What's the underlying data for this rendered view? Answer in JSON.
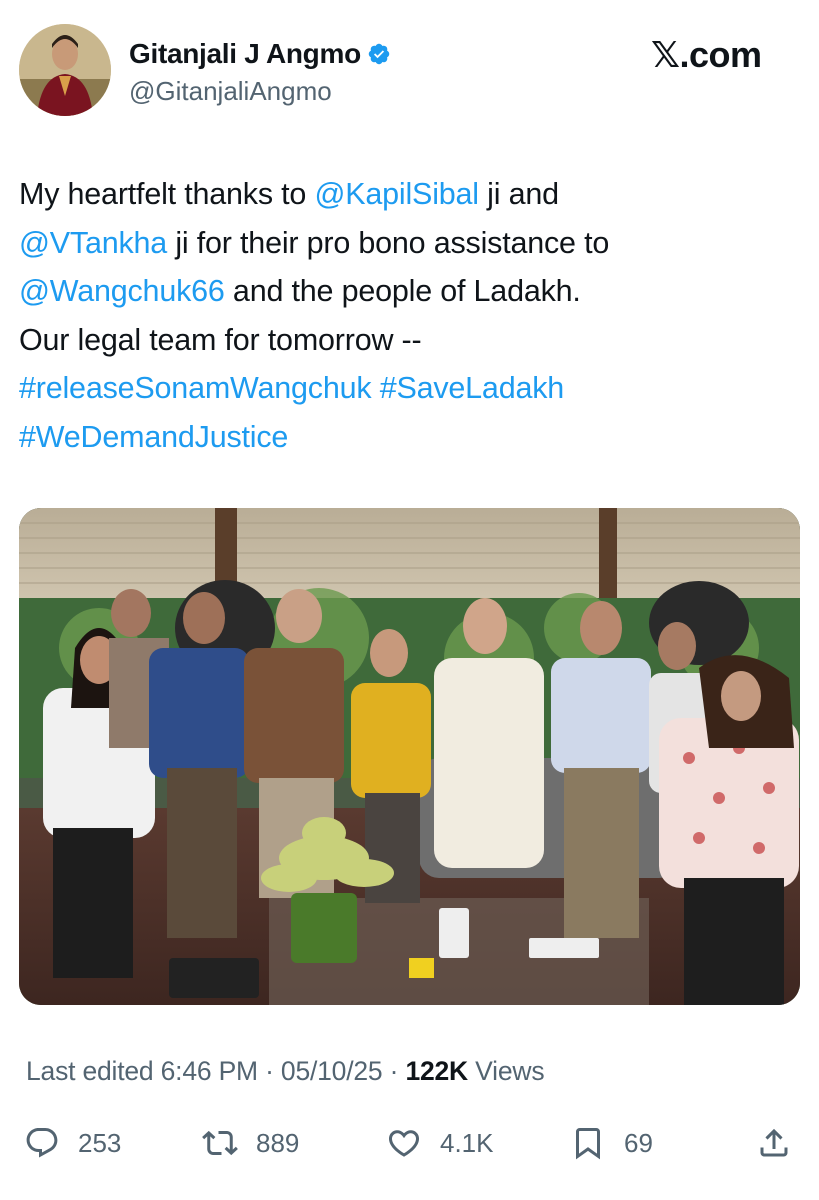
{
  "author": {
    "display_name": "Gitanjali J Angmo",
    "handle": "@GitanjaliAngmo",
    "verified": true,
    "verified_color": "#1d9bf0"
  },
  "brand": {
    "logo_text": "𝕏.com"
  },
  "tweet": {
    "lines": [
      [
        {
          "text": "My heartfelt thanks to ",
          "link": false
        },
        {
          "text": "@KapilSibal",
          "link": true
        },
        {
          "text": " ji and",
          "link": false
        }
      ],
      [
        {
          "text": "@VTankha",
          "link": true
        },
        {
          "text": " ji for their pro bono assistance to",
          "link": false
        }
      ],
      [
        {
          "text": "@Wangchuk66",
          "link": true
        },
        {
          "text": " and the people of Ladakh.",
          "link": false
        }
      ],
      [
        {
          "text": "Our legal team for tomorrow --",
          "link": false
        }
      ],
      [
        {
          "text": "#releaseSonamWangchuk",
          "link": true
        },
        {
          "text": " ",
          "link": false
        },
        {
          "text": "#SaveLadakh",
          "link": true
        }
      ],
      [
        {
          "text": "#WeDemandJustice",
          "link": true
        }
      ]
    ],
    "link_color": "#1d9bf0"
  },
  "meta": {
    "edited_prefix": "Last edited",
    "time": "6:46 PM",
    "separator": "·",
    "date": "05/10/25",
    "views_count": "122K",
    "views_label": "Views"
  },
  "actions": {
    "replies": {
      "icon": "reply-icon",
      "count": "253"
    },
    "reposts": {
      "icon": "repost-icon",
      "count": "889"
    },
    "likes": {
      "icon": "heart-icon",
      "count": "4.1K"
    },
    "bookmarks": {
      "icon": "bookmark-icon",
      "count": "69"
    },
    "share": {
      "icon": "share-icon"
    }
  }
}
